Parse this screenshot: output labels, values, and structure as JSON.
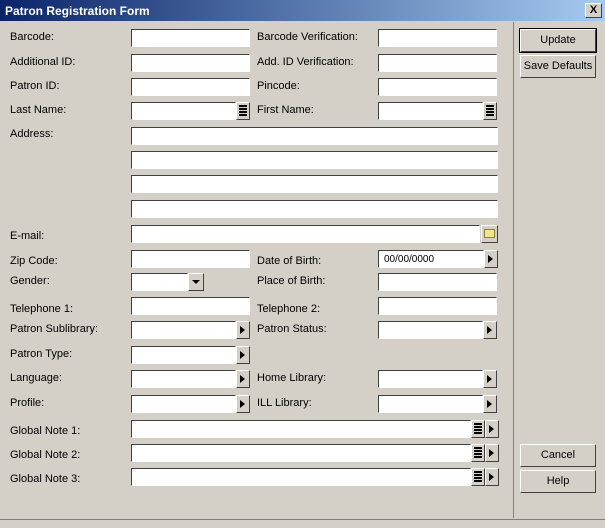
{
  "window": {
    "title": "Patron Registration Form",
    "close_label": "X"
  },
  "labels": {
    "barcode": "Barcode:",
    "barcode_verification": "Barcode Verification:",
    "additional_id": "Additional ID:",
    "add_id_verification": "Add. ID Verification:",
    "patron_id": "Patron ID:",
    "pincode": "Pincode:",
    "last_name": "Last Name:",
    "first_name": "First Name:",
    "address": "Address:",
    "email": "E-mail:",
    "zip_code": "Zip Code:",
    "date_of_birth": "Date of Birth:",
    "gender": "Gender:",
    "place_of_birth": "Place of Birth:",
    "telephone1": "Telephone 1:",
    "telephone2": "Telephone 2:",
    "patron_sublibrary": "Patron Sublibrary:",
    "patron_status": "Patron Status:",
    "patron_type": "Patron Type:",
    "language": "Language:",
    "home_library": "Home Library:",
    "profile": "Profile:",
    "ill_library": "ILL Library:",
    "global_note1": "Global Note 1:",
    "global_note2": "Global Note 2:",
    "global_note3": "Global Note 3:"
  },
  "values": {
    "date_of_birth": "00/00/0000"
  },
  "buttons": {
    "update": "Update",
    "save_defaults": "Save Defaults",
    "cancel": "Cancel",
    "help": "Help"
  }
}
